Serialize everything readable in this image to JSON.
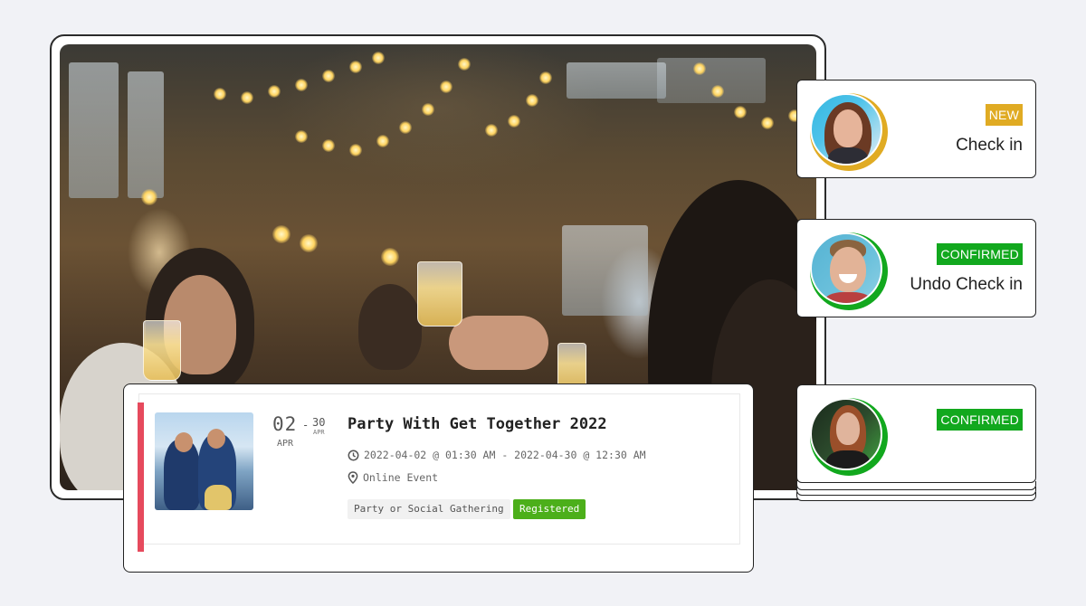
{
  "colors": {
    "accent_bar": "#e64a5d",
    "new_badge": "#e0ab23",
    "confirmed_badge": "#12a81e",
    "registered_tag": "#4caf1a"
  },
  "event": {
    "start_day": "02",
    "start_month": "APR",
    "end_day": "30",
    "end_month": "APR",
    "title": "Party With Get Together 2022",
    "datetime": "2022-04-02 @ 01:30 AM - 2022-04-30 @ 12:30 AM",
    "location": "Online Event",
    "category": "Party or Social Gathering",
    "status": "Registered",
    "icons": {
      "clock": "clock-icon",
      "location": "map-pin-icon"
    }
  },
  "attendees": [
    {
      "badge": "NEW",
      "action": "Check in",
      "ring_color": "#e0ab23"
    },
    {
      "badge": "CONFIRMED",
      "action": "Undo Check in",
      "ring_color": "#12a81e"
    },
    {
      "badge": "CONFIRMED",
      "action": "",
      "ring_color": "#12a81e"
    }
  ]
}
